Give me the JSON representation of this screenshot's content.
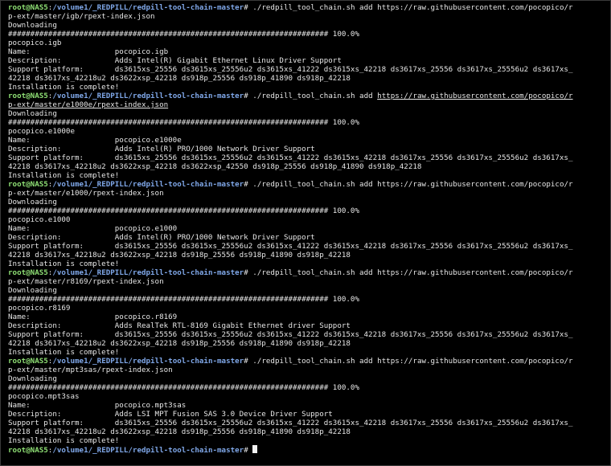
{
  "colors": {
    "background": "#000000",
    "text": "#e6e6e6",
    "prompt_user": "#8ede74",
    "prompt_path": "#7fa7e8"
  },
  "prompt": {
    "user": "root@NAS5",
    "separator": ":",
    "path": "/volume1/_REDPILL/redpill-tool-chain-master",
    "symbol": "#"
  },
  "blocks": [
    {
      "command_a": " ./redpill_tool_chain.sh add https://raw.githubusercontent.com/pocopico/r",
      "command_b": "p-ext/master/igb/rpext-index.json",
      "downloading": "Downloading",
      "progress": "######################################################################## 100.0%",
      "package": "pocopico.igb",
      "name_line": "Name:                   pocopico.igb",
      "description_line": "Description:            Adds Intel(R) Gigabit Ethernet Linux Driver Support",
      "platform_line_a": "Support platform:       ds3615xs_25556 ds3615xs_25556u2 ds3615xs_41222 ds3615xs_42218 ds3617xs_25556 ds3617xs_25556u2 ds3617xs_",
      "platform_line_b": "42218 ds3617xs_42218u2 ds3622xsp_42218 ds918p_25556 ds918p_41890 ds918p_42218",
      "complete": "Installation is complete!"
    },
    {
      "command_a_prefix": " ./redpill_tool_chain.sh add ",
      "command_a_link": "https://raw.githubusercontent.com/pocopico/r",
      "command_b_link": "p-ext/master/e1000e/rpext-index.json",
      "downloading": "Downloading",
      "progress": "######################################################################## 100.0%",
      "package": "pocopico.e1000e",
      "name_line": "Name:                   pocopico.e1000e",
      "description_line": "Description:            Adds Intel(R) PRO/1000 Network Driver Support",
      "platform_line_a": "Support platform:       ds3615xs_25556 ds3615xs_25556u2 ds3615xs_41222 ds3615xs_42218 ds3617xs_25556 ds3617xs_25556u2 ds3617xs_",
      "platform_line_b": "42218 ds3617xs_42218u2 ds3622xsp_42218 ds3622xsp_42550 ds918p_25556 ds918p_41890 ds918p_42218",
      "complete": "Installation is complete!"
    },
    {
      "command_a": " ./redpill_tool_chain.sh add https://raw.githubusercontent.com/pocopico/r",
      "command_b": "p-ext/master/e1000/rpext-index.json",
      "downloading": "Downloading",
      "progress": "######################################################################## 100.0%",
      "package": "pocopico.e1000",
      "name_line": "Name:                   pocopico.e1000",
      "description_line": "Description:            Adds Intel(R) PRO/1000 Network Driver Support",
      "platform_line_a": "Support platform:       ds3615xs_25556 ds3615xs_25556u2 ds3615xs_41222 ds3615xs_42218 ds3617xs_25556 ds3617xs_25556u2 ds3617xs_",
      "platform_line_b": "42218 ds3617xs_42218u2 ds3622xsp_42218 ds918p_25556 ds918p_41890 ds918p_42218",
      "complete": "Installation is complete!"
    },
    {
      "command_a": " ./redpill_tool_chain.sh add https://raw.githubusercontent.com/pocopico/r",
      "command_b": "p-ext/master/r8169/rpext-index.json",
      "downloading": "Downloading",
      "progress": "######################################################################## 100.0%",
      "package": "pocopico.r8169",
      "name_line": "Name:                   pocopico.r8169",
      "description_line": "Description:            Adds RealTek RTL-8169 Gigabit Ethernet driver Support",
      "platform_line_a": "Support platform:       ds3615xs_25556 ds3615xs_25556u2 ds3615xs_41222 ds3615xs_42218 ds3617xs_25556 ds3617xs_25556u2 ds3617xs_",
      "platform_line_b": "42218 ds3617xs_42218u2 ds3622xsp_42218 ds918p_25556 ds918p_41890 ds918p_42218",
      "complete": "Installation is complete!"
    },
    {
      "command_a": " ./redpill_tool_chain.sh add https://raw.githubusercontent.com/pocopico/r",
      "command_b": "p-ext/master/mpt3sas/rpext-index.json",
      "downloading": "Downloading",
      "progress": "######################################################################## 100.0%",
      "package": "pocopico.mpt3sas",
      "name_line": "Name:                   pocopico.mpt3sas",
      "description_line": "Description:            Adds LSI MPT Fusion SAS 3.0 Device Driver Support",
      "platform_line_a": "Support platform:       ds3615xs_25556 ds3615xs_25556u2 ds3615xs_41222 ds3615xs_42218 ds3617xs_25556 ds3617xs_25556u2 ds3617xs_",
      "platform_line_b": "42218 ds3617xs_42218u2 ds3622xsp_42218 ds918p_25556 ds918p_41890 ds918p_42218",
      "complete": "Installation is complete!"
    }
  ]
}
